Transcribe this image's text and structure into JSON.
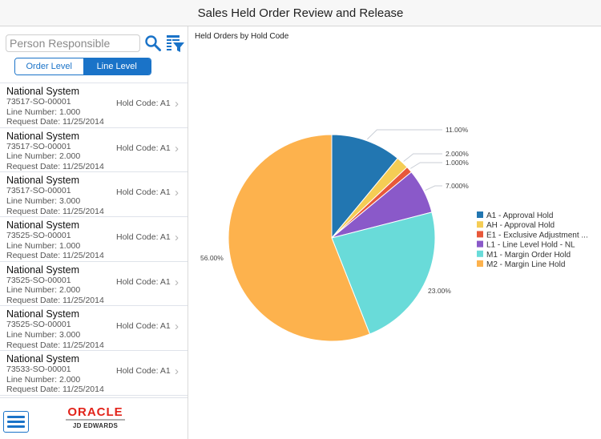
{
  "header": {
    "title": "Sales Held Order Review and Release"
  },
  "search": {
    "placeholder": "Person Responsible",
    "value": ""
  },
  "icons": {
    "search": "search-icon",
    "filter": "filter-list-icon",
    "menu": "hamburger-menu-icon",
    "chevron": "chevron-right-icon"
  },
  "segmented": {
    "options": [
      "Order Level",
      "Line Level"
    ],
    "selected": "Line Level"
  },
  "list": {
    "items": [
      {
        "title": "National System",
        "order": "73517-SO-00001",
        "line": "Line Number: 1.000",
        "date": "Request Date: 11/25/2014",
        "hold": "Hold Code: A1"
      },
      {
        "title": "National System",
        "order": "73517-SO-00001",
        "line": "Line Number: 2.000",
        "date": "Request Date: 11/25/2014",
        "hold": "Hold Code: A1"
      },
      {
        "title": "National System",
        "order": "73517-SO-00001",
        "line": "Line Number: 3.000",
        "date": "Request Date: 11/25/2014",
        "hold": "Hold Code: A1"
      },
      {
        "title": "National System",
        "order": "73525-SO-00001",
        "line": "Line Number: 1.000",
        "date": "Request Date: 11/25/2014",
        "hold": "Hold Code: A1"
      },
      {
        "title": "National System",
        "order": "73525-SO-00001",
        "line": "Line Number: 2.000",
        "date": "Request Date: 11/25/2014",
        "hold": "Hold Code: A1"
      },
      {
        "title": "National System",
        "order": "73525-SO-00001",
        "line": "Line Number: 3.000",
        "date": "Request Date: 11/25/2014",
        "hold": "Hold Code: A1"
      },
      {
        "title": "National System",
        "order": "73533-SO-00001",
        "line": "Line Number: 2.000",
        "date": "Request Date: 11/25/2014",
        "hold": "Hold Code: A1"
      }
    ]
  },
  "footer": {
    "logo_top": "ORACLE",
    "logo_bottom": "JD EDWARDS"
  },
  "chart_data": {
    "type": "pie",
    "title": "Held Orders by Hold Code",
    "legend_position": "right",
    "slices": [
      {
        "name": "A1 - Approval Hold",
        "value": 11,
        "label": "11.00%",
        "color": "#2276b1"
      },
      {
        "name": "AH - Approval Hold",
        "value": 2,
        "label": "2.000%",
        "color": "#f5cd55"
      },
      {
        "name": "E1 - Exclusive Adjustment ...",
        "value": 1,
        "label": "1.000%",
        "color": "#e8583a"
      },
      {
        "name": "L1 - Line Level Hold - NL",
        "value": 7,
        "label": "7.000%",
        "color": "#8a59c9"
      },
      {
        "name": "M1 - Margin Order Hold",
        "value": 23,
        "label": "23.00%",
        "color": "#69dbd9"
      },
      {
        "name": "M2 - Margin Line Hold",
        "value": 56,
        "label": "56.00%",
        "color": "#fdb24d"
      }
    ]
  }
}
